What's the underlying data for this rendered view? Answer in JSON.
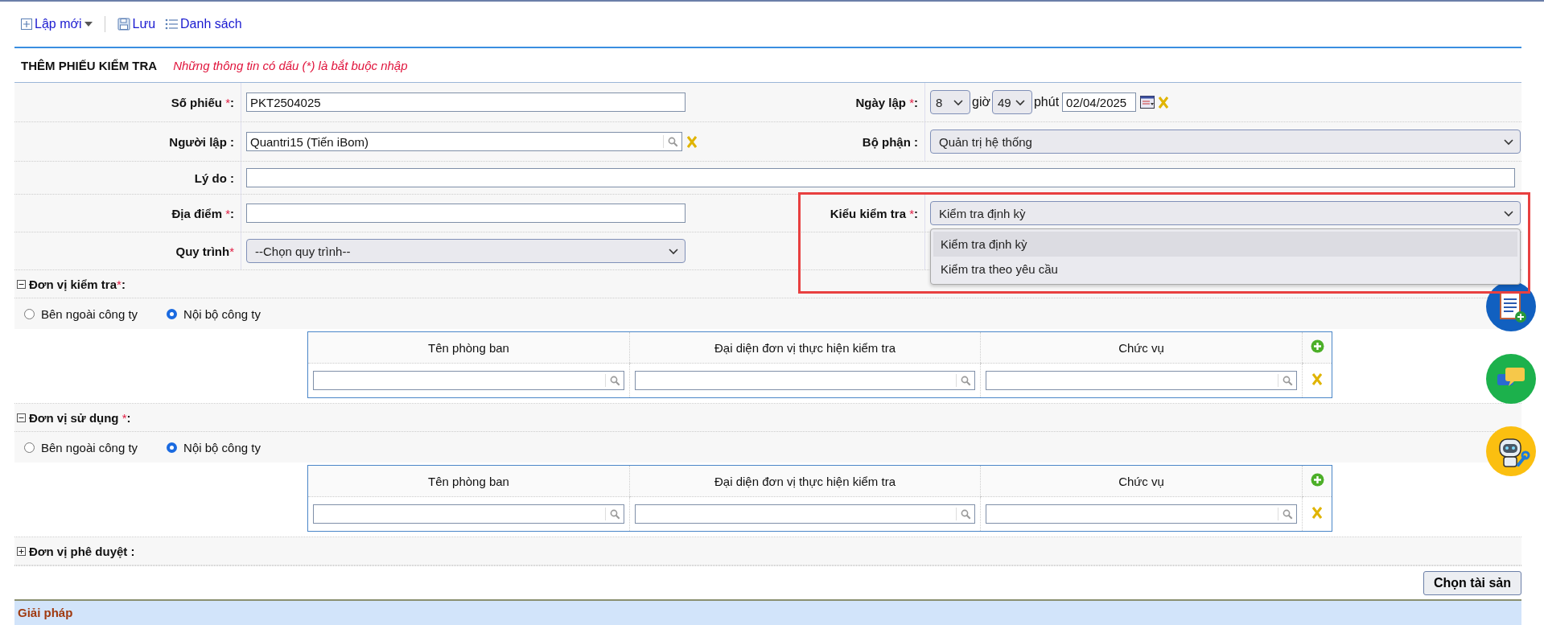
{
  "toolbar": [
    {
      "kind": "new",
      "label": "Lập mới",
      "dropdown": true
    },
    {
      "kind": "save",
      "label": "Lưu",
      "dropdown": false
    },
    {
      "kind": "list",
      "label": "Danh sách",
      "dropdown": false
    }
  ],
  "form_title": "THÊM PHIẾU KIỂM TRA",
  "required_note": "Những thông tin có dấu (*) là bắt buộc nhập",
  "rows": [
    {
      "left": {
        "label": "Số phiếu ",
        "required_mark": "*",
        "suffix": ":",
        "kind": "text",
        "value": "PKT2504025"
      },
      "right": {
        "label": "Ngày lập ",
        "required_mark": "*",
        "suffix": ":",
        "kind": "datetime",
        "hour": "8",
        "hour_unit": "giờ",
        "minute": "49",
        "minute_unit": "phút",
        "date": "02/04/2025"
      }
    },
    {
      "left": {
        "label": "Người lập :",
        "kind": "lookup",
        "value": "Quantri15 (Tiến iBom)"
      },
      "right": {
        "label": "Bộ phận :",
        "kind": "select",
        "value": "Quản trị hệ thống"
      }
    },
    {
      "wide": {
        "label": "Lý do :",
        "kind": "text"
      }
    },
    {
      "left": {
        "label": "Địa điểm ",
        "required_mark": "*",
        "suffix": ":",
        "kind": "text"
      },
      "right": {
        "label": "Kiểu kiểm tra ",
        "required_mark": "*",
        "suffix": ":",
        "kind": "select",
        "value": "Kiểm tra định kỳ",
        "expanded": true,
        "highlighted": true,
        "options": [
          {
            "label": "Kiểm tra định kỳ",
            "selected": true
          },
          {
            "label": "Kiểm tra theo yêu cầu",
            "selected": false
          }
        ]
      }
    },
    {
      "left": {
        "label": "Quy trình",
        "required_mark": "*",
        "kind": "select",
        "value": "--Chọn quy trình--"
      }
    }
  ],
  "sections": [
    {
      "title": "Đơn vị kiểm tra",
      "required_mark": "*",
      "suffix": ":",
      "expanded": true,
      "radios": [
        {
          "label": "Bên ngoài công ty",
          "selected": false
        },
        {
          "label": "Nội bộ công ty",
          "selected": true
        }
      ],
      "columns": [
        "Tên phòng ban",
        "Đại diện đơn vị thực hiện kiểm tra",
        "Chức vụ"
      ]
    },
    {
      "title": "Đơn vị sử dụng ",
      "required_mark": "*",
      "suffix": ":",
      "expanded": true,
      "radios": [
        {
          "label": "Bên ngoài công ty",
          "selected": false
        },
        {
          "label": "Nội bộ công ty",
          "selected": true
        }
      ],
      "columns": [
        "Tên phòng ban",
        "Đại diện đơn vị thực hiện kiểm tra",
        "Chức vụ"
      ]
    },
    {
      "title": "Đơn vị phê duyệt :",
      "expanded": false
    }
  ],
  "action_button": "Chọn tài sản",
  "bottom_section": "Giải pháp"
}
